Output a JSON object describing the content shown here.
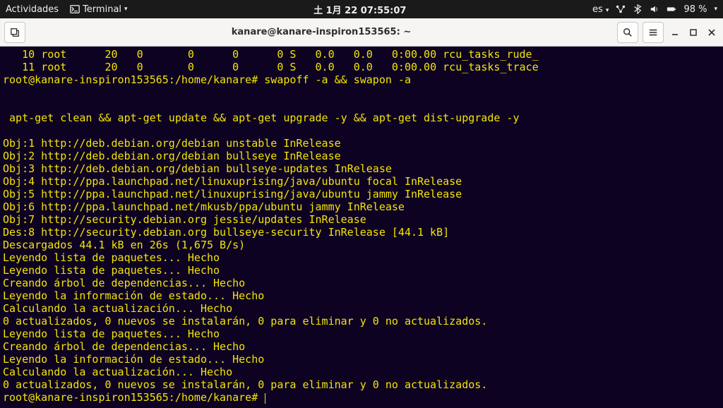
{
  "topbar": {
    "activities": "Actividades",
    "app_name": "Terminal",
    "datetime": "土  1月 22  07:55:07",
    "lang": "es",
    "battery": "98 %"
  },
  "titlebar": {
    "title": "kanare@kanare-inspiron153565: ~"
  },
  "ps": {
    "row1": {
      "pid": "10",
      "user": "root",
      "pr": "20",
      "ni": "0",
      "virt": "0",
      "res": "0",
      "shr": "0",
      "s": "S",
      "cpu": "0.0",
      "mem": "0.0",
      "time": "0:00.00",
      "cmd": "rcu_tasks_rude_"
    },
    "row2": {
      "pid": "11",
      "user": "root",
      "pr": "20",
      "ni": "0",
      "virt": "0",
      "res": "0",
      "shr": "0",
      "s": "S",
      "cpu": "0.0",
      "mem": "0.0",
      "time": "0:00.00",
      "cmd": "rcu_tasks_trace"
    }
  },
  "prompt1": {
    "host": "root@kanare-inspiron153565:/home/kanare#",
    "cmd": "swapoff -a && swapon -a"
  },
  "cmd2": " apt-get clean && apt-get update && apt-get upgrade -y && apt-get dist-upgrade -y",
  "lines": {
    "l1": "Obj:1 http://deb.debian.org/debian unstable InRelease",
    "l2": "Obj:2 http://deb.debian.org/debian bullseye InRelease",
    "l3": "Obj:3 http://deb.debian.org/debian bullseye-updates InRelease",
    "l4": "Obj:4 http://ppa.launchpad.net/linuxuprising/java/ubuntu focal InRelease",
    "l5": "Obj:5 http://ppa.launchpad.net/linuxuprising/java/ubuntu jammy InRelease",
    "l6": "Obj:6 http://ppa.launchpad.net/mkusb/ppa/ubuntu jammy InRelease",
    "l7": "Obj:7 http://security.debian.org jessie/updates InRelease",
    "l8": "Des:8 http://security.debian.org bullseye-security InRelease [44.1 kB]",
    "l9": "Descargados 44.1 kB en 26s (1,675 B/s)",
    "l10": "Leyendo lista de paquetes... Hecho",
    "l11": "Leyendo lista de paquetes... Hecho",
    "l12": "Creando árbol de dependencias... Hecho",
    "l13": "Leyendo la información de estado... Hecho",
    "l14": "Calculando la actualización... Hecho",
    "l15": "0 actualizados, 0 nuevos se instalarán, 0 para eliminar y 0 no actualizados.",
    "l16": "Leyendo lista de paquetes... Hecho",
    "l17": "Creando árbol de dependencias... Hecho",
    "l18": "Leyendo la información de estado... Hecho",
    "l19": "Calculando la actualización... Hecho",
    "l20": "0 actualizados, 0 nuevos se instalarán, 0 para eliminar y 0 no actualizados."
  },
  "prompt2": "root@kanare-inspiron153565:/home/kanare# "
}
